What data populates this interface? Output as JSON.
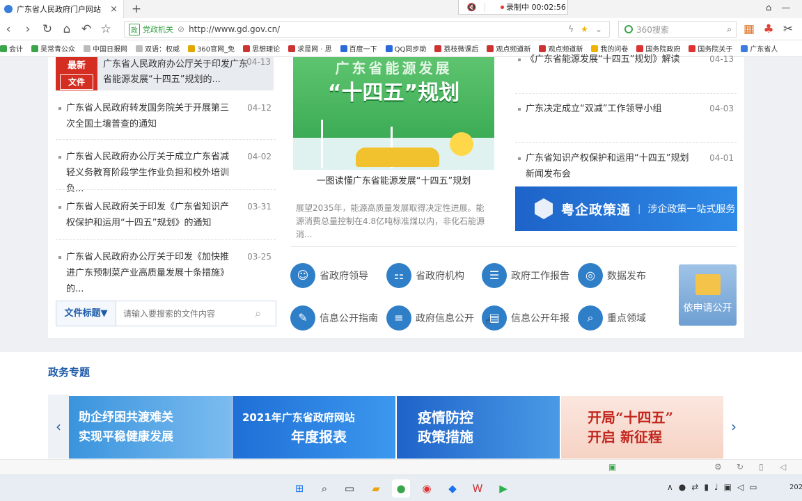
{
  "browser": {
    "tab_title": "广东省人民政府门户网站",
    "tab_close": "×",
    "new_tab": "+",
    "recording_text": "录制中 00:02:56",
    "address_badge": "党政机关",
    "url": "http://www.gd.gov.cn/",
    "search_placeholder": "360搜索",
    "bookmarks": [
      "会计",
      "吴常青公众",
      "中国日报网",
      "双语：权威",
      "360官网_免",
      "思想理论",
      "求是网 · 思",
      "百度一下",
      "QQ同步助",
      "荔枝微课后",
      "观点频道新",
      "观点频道新",
      "我的问卷",
      "国务院政府",
      "国务院关于",
      "广东省人"
    ]
  },
  "colors": {
    "accent": "#1d5aa9",
    "tag_red": "#d42d22",
    "icon_blue": "#2f7fc8"
  },
  "news_left": {
    "latest": {
      "tag_top": "最新",
      "tag_bottom": "文件",
      "title": "广东省人民政府办公厅关于印发广东省能源发展“十四五”规划的...",
      "date": "04-13"
    },
    "items": [
      {
        "title": "广东省人民政府转发国务院关于开展第三次全国土壤普查的通知",
        "date": "04-12"
      },
      {
        "title": "广东省人民政府办公厅关于成立广东省减轻义务教育阶段学生作业负担和校外培训负...",
        "date": "04-02"
      },
      {
        "title": "广东省人民政府关于印发《广东省知识产权保护和运用“十四五”规划》的通知",
        "date": "03-31"
      },
      {
        "title": "广东省人民政府办公厅关于印发《加快推进广东预制菜产业高质量发展十条措施》的...",
        "date": "03-25"
      }
    ],
    "search_select": "文件标题▼",
    "search_placeholder": "请输入要搜索的文件内容"
  },
  "feature": {
    "banner_line1": "广东省能源发展",
    "banner_line2": "“十四五”规划",
    "caption": "一图读懂广东省能源发展“十四五”规划",
    "summary": "展望2035年，能源高质量发展取得决定性进展。能源消费总量控制在4.8亿吨标准煤以内，非化石能源消..."
  },
  "news_right": {
    "items": [
      {
        "title": "《广东省能源发展“十四五”规划》解读",
        "date": "04-13"
      },
      {
        "title": "广东决定成立“双减”工作领导小组",
        "date": "04-03"
      },
      {
        "title": "广东省知识产权保护和运用“十四五”规划新闻发布会",
        "date": "04-01"
      }
    ],
    "banner_big": "粤企政策通",
    "banner_bar": "|",
    "banner_small": "涉企政策一站式服务"
  },
  "quick_links": [
    {
      "label": "省政府领导",
      "icon": "person-icon",
      "glyph": "☺"
    },
    {
      "label": "省政府机构",
      "icon": "org-chart-icon",
      "glyph": "⚏"
    },
    {
      "label": "政府工作报告",
      "icon": "document-icon",
      "glyph": "☰"
    },
    {
      "label": "数据发布",
      "icon": "data-ring-icon",
      "glyph": "◎"
    },
    {
      "label": "信息公开指南",
      "icon": "compass-icon",
      "glyph": "✎"
    },
    {
      "label": "政府信息公开",
      "icon": "list-icon",
      "glyph": "≡"
    },
    {
      "label": "信息公开年报",
      "icon": "report-icon",
      "glyph": "▤"
    },
    {
      "label": "重点领域",
      "icon": "search-doc-icon",
      "glyph": "⌕"
    }
  ],
  "apply_label": "依申请公开",
  "topics": {
    "title": "政务专题",
    "prev": "‹",
    "next": "›",
    "slides": [
      {
        "l1": "助企纾困共渡难关",
        "l2": "实现平稳健康发展"
      },
      {
        "l1": "2021年广东省政府网站",
        "l2": "年度报表"
      },
      {
        "l1": "疫情防控",
        "l2": "政策措施"
      },
      {
        "l1": "开局“十四五”",
        "l2": "开启 新征程"
      }
    ]
  },
  "taskbar": {
    "clock": "202"
  }
}
